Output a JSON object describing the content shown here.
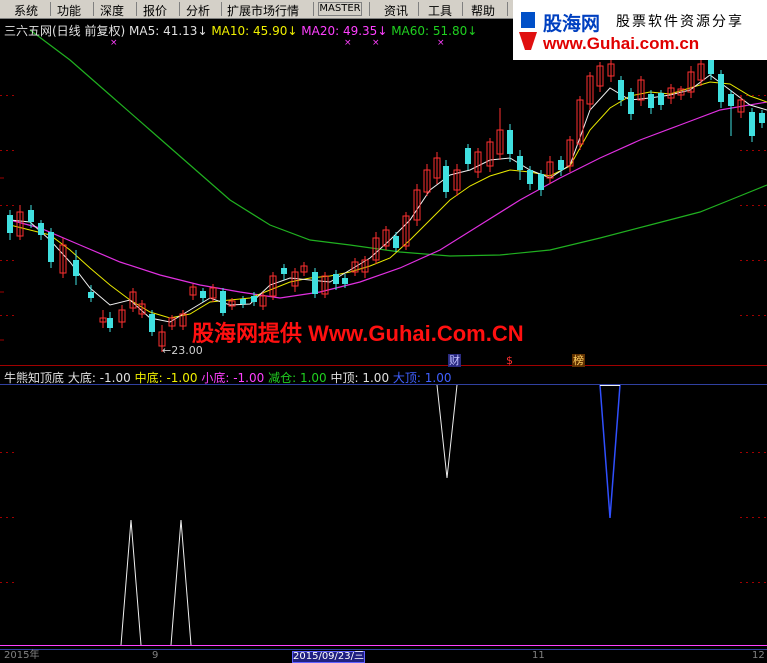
{
  "menu": {
    "items": [
      "系统",
      "功能",
      "深度",
      "报价",
      "分析",
      "扩展市场行情",
      "MASTER",
      "资讯",
      "工具",
      "帮助"
    ],
    "cut_item": "股票"
  },
  "logo": {
    "cn_name": "股海网",
    "slogan": "股票软件资源分享",
    "url": "www.Guhai.com.cn"
  },
  "chart": {
    "stock_name": "三六五网(日线 前复权)",
    "ma": [
      {
        "label": "MA5: 41.13",
        "color": "#e0e0e0"
      },
      {
        "label": "MA10: 45.90",
        "color": "#f0f000"
      },
      {
        "label": "MA20: 49.35",
        "color": "#ff40ff"
      },
      {
        "label": "MA60: 51.80",
        "color": "#20d020"
      }
    ],
    "low_label": "←23.00",
    "tags": {
      "cai": "财",
      "dollar": "$",
      "bang": "榜"
    },
    "watermark": "股海网提供 Www.Guhai.Com.CN"
  },
  "indicator": {
    "name": "牛熊知顶底",
    "values": [
      {
        "label": "大底: -1.00",
        "color": "#e0e0e0"
      },
      {
        "label": "中底: -1.00",
        "color": "#f0f000"
      },
      {
        "label": "小底: -1.00",
        "color": "#ff40ff"
      },
      {
        "label": "减仓: 1.00",
        "color": "#20d020"
      },
      {
        "label": "中顶: 1.00",
        "color": "#e0e0e0"
      },
      {
        "label": "大顶: 1.00",
        "color": "#4060ff"
      }
    ]
  },
  "dates": {
    "left": "2015年",
    "d9": "9",
    "selected": "2015/09/23/三",
    "d11": "11",
    "d12": "12"
  }
}
